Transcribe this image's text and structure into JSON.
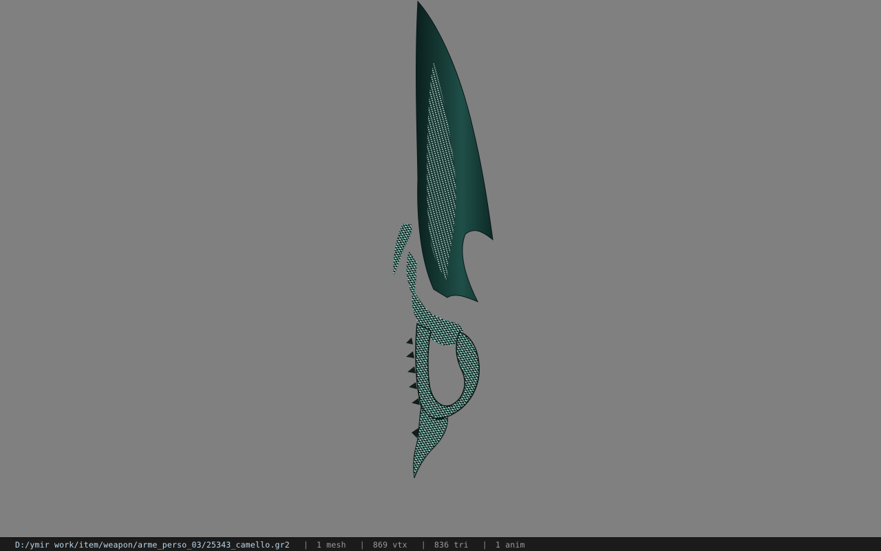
{
  "viewport": {
    "background_color": "#808080",
    "model_colors": {
      "blade_dark": "#0d2a26",
      "blade_mid": "#1f4f48",
      "scale_light": "#9fd3c8",
      "scale_dark": "#0b1614"
    }
  },
  "status_bar": {
    "file_path": "D:/ymir work/item/weapon/arme_perso_03/25343_camello.gr2",
    "separator": "|",
    "mesh_count": "1 mesh",
    "vertex_count": "869 vtx",
    "triangle_count": "836 tri",
    "anim_count": "1 anim"
  }
}
